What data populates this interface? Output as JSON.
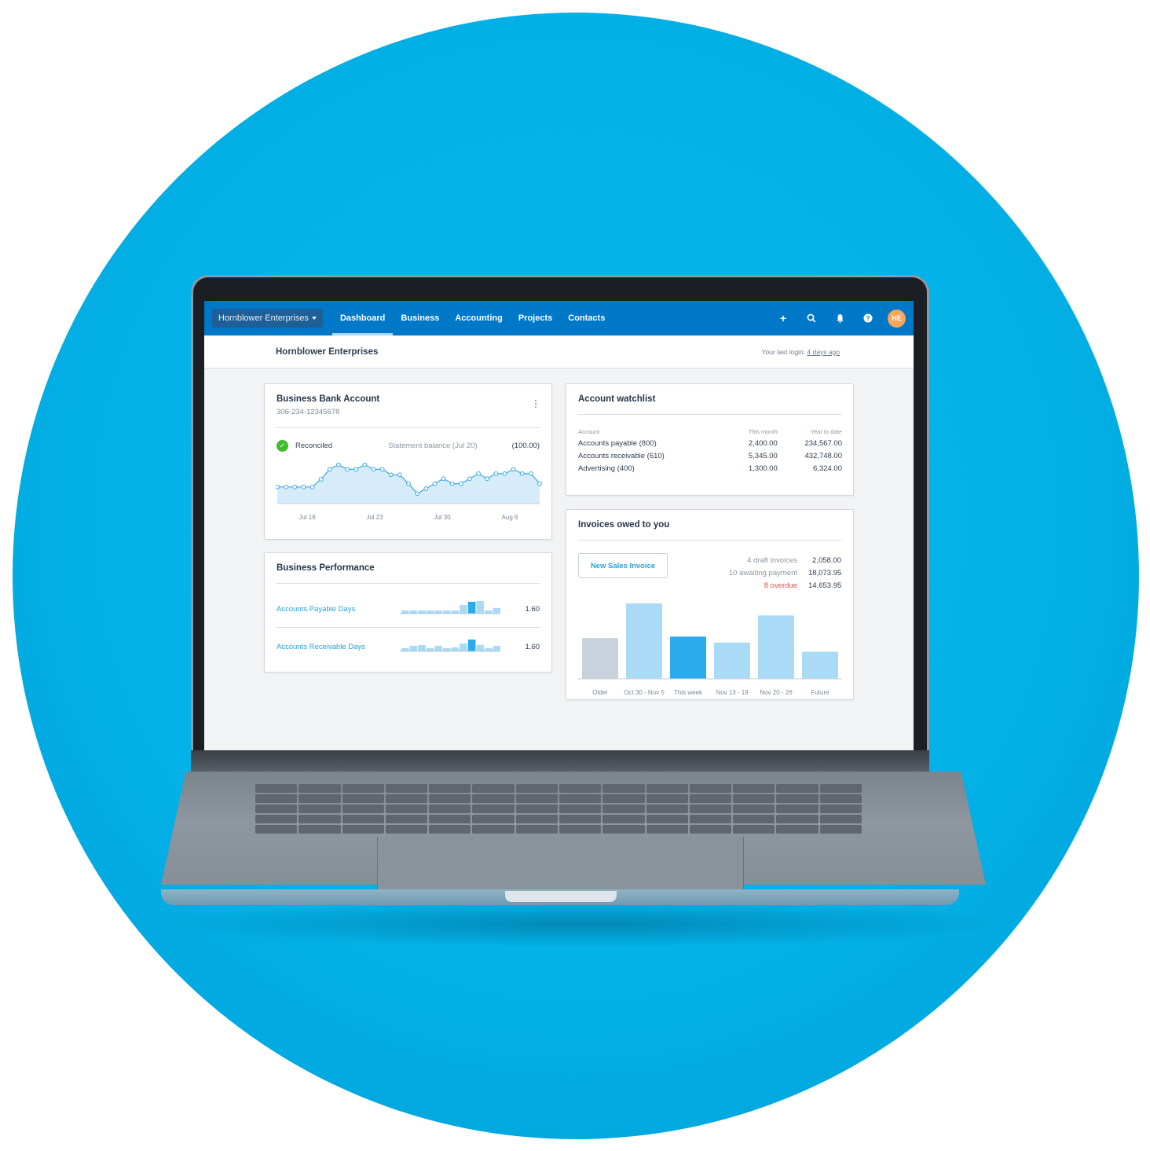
{
  "nav": {
    "org_switcher": "Hornblower Enterprises",
    "tabs": [
      {
        "label": "Dashboard",
        "active": true
      },
      {
        "label": "Business",
        "active": false
      },
      {
        "label": "Accounting",
        "active": false
      },
      {
        "label": "Projects",
        "active": false
      },
      {
        "label": "Contacts",
        "active": false
      }
    ],
    "icons": [
      "plus-icon",
      "search-icon",
      "bell-icon",
      "help-icon"
    ],
    "avatar_initials": "HE",
    "avatar_color": "#f8a65b",
    "brand_color": "#0078c8"
  },
  "subheader": {
    "title": "Hornblower Enterprises",
    "last_login_prefix": "Your last login: ",
    "last_login_value": "4 days ago"
  },
  "bank_account": {
    "title": "Business Bank Account",
    "account_number": "306-234-12345678",
    "status": "Reconciled",
    "statement_label": "Statement balance (Jul 20)",
    "statement_value": "(100.00)",
    "chart_data": {
      "type": "area",
      "x_tick_labels": [
        "Jul 16",
        "Jul 23",
        "Jul 30",
        "Aug 6"
      ],
      "values": [
        30,
        30,
        30,
        30,
        30,
        44,
        62,
        70,
        62,
        62,
        70,
        62,
        62,
        52,
        52,
        36,
        18,
        27,
        36,
        45,
        36,
        36,
        45,
        54,
        45,
        54,
        54,
        62,
        54,
        54,
        36
      ],
      "ylim": [
        0,
        85
      ]
    }
  },
  "performance": {
    "title": "Business Performance",
    "rows": [
      {
        "label": "Accounts Payable Days",
        "value": "1.60",
        "bars": [
          4,
          4,
          4,
          4,
          4,
          4,
          4,
          11,
          15,
          16,
          4,
          7
        ],
        "highlight": 8
      },
      {
        "label": "Accounts Receivable Days",
        "value": "1.60",
        "bars": [
          4,
          7,
          8,
          4,
          7,
          4,
          5,
          10,
          15,
          8,
          4,
          7
        ],
        "highlight": 8
      }
    ]
  },
  "watchlist": {
    "title": "Account watchlist",
    "columns": [
      "Account",
      "This month",
      "Year to date"
    ],
    "rows": [
      [
        "Accounts payable (800)",
        "2,400.00",
        "234,567.00"
      ],
      [
        "Accounts receivable (610)",
        "5,345.00",
        "432,748.00"
      ],
      [
        "Advertising (400)",
        "1,300.00",
        "6,324.00"
      ]
    ]
  },
  "invoices": {
    "title": "Invoices owed to you",
    "new_button": "New Sales Invoice",
    "summary": [
      {
        "label": "4 draft invoices",
        "value": "2,058.00",
        "overdue": false
      },
      {
        "label": "10 awaiting payment",
        "value": "18,073.95",
        "overdue": false
      },
      {
        "label": "8 overdue",
        "value": "14,653.95",
        "overdue": true
      }
    ],
    "chart_data": {
      "type": "bar",
      "categories": [
        "Older",
        "Oct 30 - Nov 5",
        "This week",
        "Nov 13 - 19",
        "Nov 20 - 26",
        "Future"
      ],
      "values": [
        54,
        100,
        56,
        48,
        84,
        36
      ],
      "colors": [
        "#c9d2dc",
        "#a9dbf6",
        "#2aabeb",
        "#a9dbf6",
        "#a9dbf6",
        "#a9dbf6"
      ],
      "ylim": [
        0,
        100
      ]
    }
  }
}
